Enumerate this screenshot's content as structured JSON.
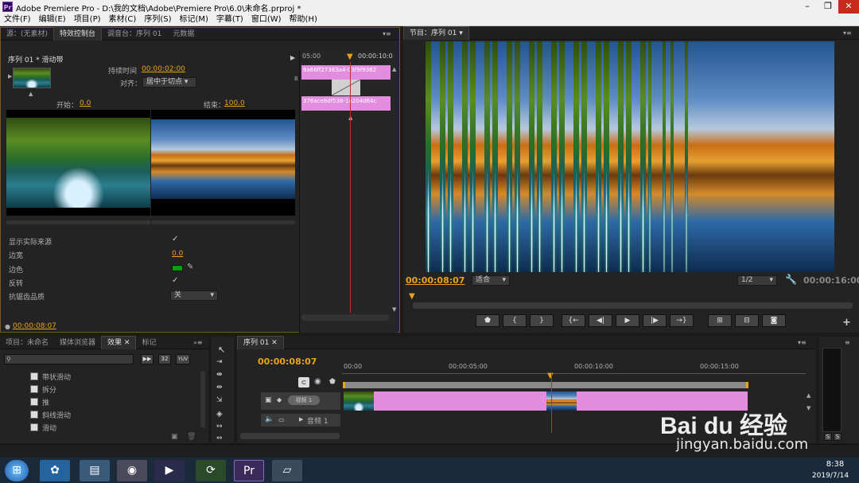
{
  "titlebar": {
    "title": "Adobe Premiere Pro - D:\\我的文档\\Adobe\\Premiere Pro\\6.0\\未命名.prproj *",
    "app_icon": "Pr"
  },
  "menu": [
    "文件(F)",
    "编辑(E)",
    "项目(P)",
    "素材(C)",
    "序列(S)",
    "标记(M)",
    "字幕(T)",
    "窗口(W)",
    "帮助(H)"
  ],
  "source_panel": {
    "tabs": [
      "源：(无素材)",
      "特效控制台",
      "调音台：序列 01",
      "元数据"
    ],
    "sequence_label": "序列 01 * 滑动带",
    "duration_label": "持续时间",
    "duration_value": "00:00:02:00",
    "align_label": "对齐：",
    "align_value": "居中于切点",
    "start_label": "开始：",
    "start_value": "0.0",
    "end_label": "结束：",
    "end_value": "100.0",
    "props": [
      {
        "label": "显示实际来源",
        "value": "✓"
      },
      {
        "label": "边宽",
        "value": "0.0"
      },
      {
        "label": "边色",
        "value": ""
      },
      {
        "label": "反转",
        "value": "✓"
      },
      {
        "label": "抗锯齿品质",
        "value": "关"
      }
    ],
    "timecode": "00:00:08:07",
    "mini_timeline": {
      "t1": "05:00",
      "t2": "00:00:10:0",
      "clip_a": "9a66ff27363a4-03f9f9362",
      "clip_b": "376ace8df538-1a204d64c",
      "track_label": "B"
    },
    "border_color": "#00a000"
  },
  "program_panel": {
    "tab": "节目：序列 01",
    "timecode": "00:00:08:07",
    "fit": "适合",
    "quality": "1/2",
    "duration": "00:00:16:00"
  },
  "project_panel": {
    "tabs": [
      "项目：未命名",
      "媒体浏览器",
      "效果",
      "标记"
    ],
    "items": [
      "带状滑动",
      "拆分",
      "推",
      "斜线滑动",
      "滑动"
    ],
    "btn_labels": [
      "32",
      "YUV"
    ]
  },
  "timeline": {
    "tab": "序列 01",
    "timecode": "00:00:08:07",
    "ruler": [
      "00:00",
      "00:00:05:00",
      "00:00:10:00",
      "00:00:15:00"
    ],
    "video_track": "视频 1",
    "audio_track": "音频 1"
  },
  "meters": [
    "S",
    "S"
  ],
  "taskbar": {
    "time": "8:38",
    "date": "2019/7/14"
  },
  "watermark": {
    "brand": "Bai du 经验",
    "url": "jingyan.baidu.com"
  },
  "colors": {
    "accent": "#e8a31a",
    "clip": "#e38de0",
    "close": "#c42b1c"
  }
}
